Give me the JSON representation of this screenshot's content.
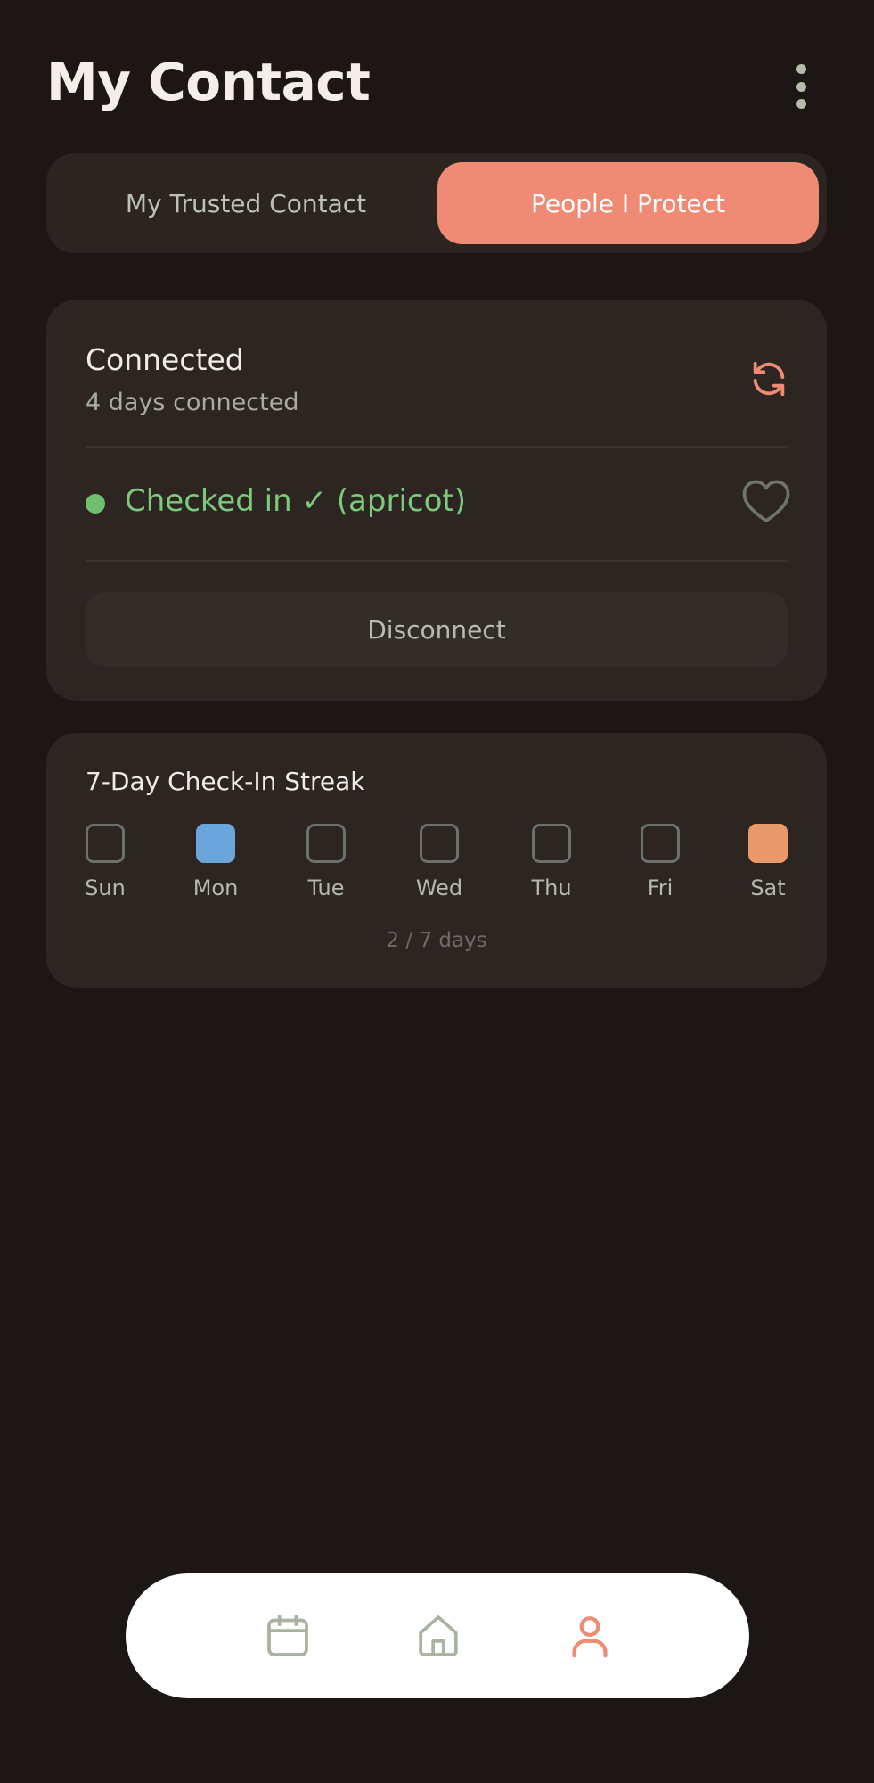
{
  "header": {
    "title": "My Contact",
    "menu_icon": "kebab-menu-icon"
  },
  "segment": {
    "tabs": [
      {
        "label": "My Trusted Contact",
        "active": false
      },
      {
        "label": "People I Protect",
        "active": true
      }
    ]
  },
  "connection": {
    "title": "Connected",
    "duration": "4 days connected",
    "refresh_icon": "refresh-icon",
    "status_text": "Checked in ✓ (apricot)",
    "status_color": "#7dc97c",
    "heart_icon": "heart-icon",
    "disconnect_label": "Disconnect"
  },
  "streak": {
    "title": "7-Day Check-In Streak",
    "days": [
      {
        "label": "Sun",
        "state": "empty"
      },
      {
        "label": "Mon",
        "state": "checked",
        "color": "#6aa6dc"
      },
      {
        "label": "Tue",
        "state": "empty"
      },
      {
        "label": "Wed",
        "state": "empty"
      },
      {
        "label": "Thu",
        "state": "empty"
      },
      {
        "label": "Fri",
        "state": "empty"
      },
      {
        "label": "Sat",
        "state": "checked",
        "color": "#e99a6c"
      }
    ],
    "count_text": "2 / 7 days"
  },
  "bottom_nav": {
    "items": [
      {
        "icon": "calendar-icon",
        "active": false
      },
      {
        "icon": "home-icon",
        "active": false
      },
      {
        "icon": "profile-icon",
        "active": true
      }
    ]
  },
  "colors": {
    "background": "#1c1715",
    "card": "#2d2522",
    "accent": "#ef8a74",
    "nav_inactive": "#a8b3a0"
  }
}
